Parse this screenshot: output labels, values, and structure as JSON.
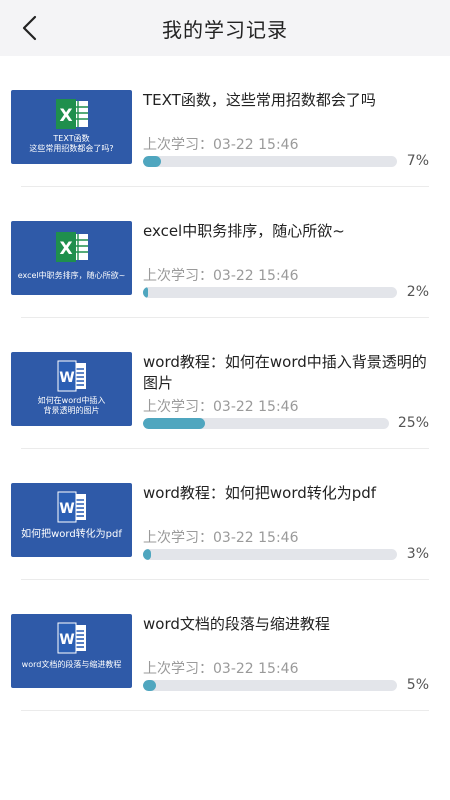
{
  "header": {
    "title": "我的学习记录"
  },
  "items": [
    {
      "title": "TEXT函数，这些常用招数都会了吗",
      "thumb_caption": "TEXT函数\n这些常用招数都会了吗?",
      "thumb_app": "excel-icon",
      "last_label": "上次学习：03-22 15:46",
      "progress": 7,
      "progress_label": "7%"
    },
    {
      "title": "excel中职务排序，随心所欲~",
      "thumb_caption": "excel中职务排序，随心所欲~",
      "thumb_app": "excel-icon",
      "last_label": "上次学习：03-22 15:46",
      "progress": 2,
      "progress_label": "2%"
    },
    {
      "title": "word教程：如何在word中插入背景透明的图片",
      "thumb_caption": "如何在word中插入\n背景透明的图片",
      "thumb_app": "word-icon",
      "last_label": "上次学习：03-22 15:46",
      "progress": 25,
      "progress_label": "25%"
    },
    {
      "title": "word教程：如何把word转化为pdf",
      "thumb_caption": "如何把word转化为pdf",
      "thumb_app": "word-icon",
      "last_label": "上次学习：03-22 15:46",
      "progress": 3,
      "progress_label": "3%"
    },
    {
      "title": "word文档的段落与缩进教程",
      "thumb_caption": "word文档的段落与缩进教程",
      "thumb_app": "word-icon",
      "last_label": "上次学习：03-22 15:46",
      "progress": 5,
      "progress_label": "5%"
    }
  ],
  "colors": {
    "thumb_bg": "#2f5aa8",
    "progress_fill": "#4fa6bf",
    "progress_track": "#e3e5ea",
    "excel_green": "#1f8f4d",
    "word_blue": "#2b5fb4"
  }
}
